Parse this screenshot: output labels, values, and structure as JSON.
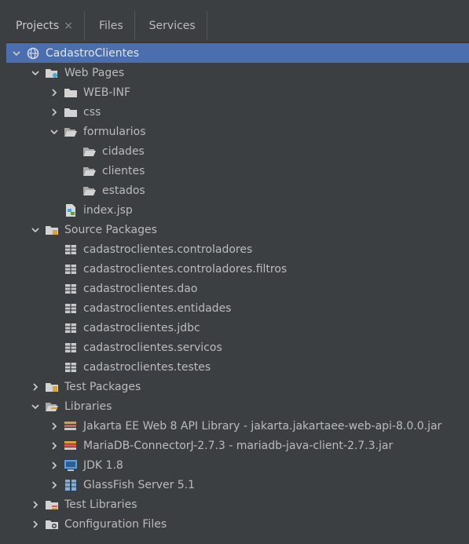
{
  "tabs": [
    {
      "label": "Projects",
      "close": "×"
    },
    {
      "label": "Files"
    },
    {
      "label": "Services"
    }
  ],
  "colors": {
    "background": "#3c3f41",
    "selection": "#4b6eaf",
    "folder": "#d3d3d3",
    "package": "#c9c9c9",
    "jar": "#d9a23a",
    "jdk": "#5aa0e6",
    "server": "#7fb0e0"
  },
  "tree": [
    {
      "label": "CadastroClientes",
      "icon": "globe-icon",
      "depth": 0,
      "chevron": "down",
      "selected": true
    },
    {
      "label": "Web Pages",
      "icon": "web-folder-icon",
      "depth": 1,
      "chevron": "down"
    },
    {
      "label": "WEB-INF",
      "icon": "folder-closed-icon",
      "depth": 2,
      "chevron": "right"
    },
    {
      "label": "css",
      "icon": "folder-closed-icon",
      "depth": 2,
      "chevron": "right"
    },
    {
      "label": "formularios",
      "icon": "folder-open-icon",
      "depth": 2,
      "chevron": "down"
    },
    {
      "label": "cidades",
      "icon": "folder-open-icon",
      "depth": 3
    },
    {
      "label": "clientes",
      "icon": "folder-open-icon",
      "depth": 3
    },
    {
      "label": "estados",
      "icon": "folder-open-icon",
      "depth": 3
    },
    {
      "label": "index.jsp",
      "icon": "jsp-file-icon",
      "depth": 2
    },
    {
      "label": "Source Packages",
      "icon": "source-folder-icon",
      "depth": 1,
      "chevron": "down"
    },
    {
      "label": "cadastroclientes.controladores",
      "icon": "package-icon",
      "depth": 2
    },
    {
      "label": "cadastroclientes.controladores.filtros",
      "icon": "package-icon",
      "depth": 2
    },
    {
      "label": "cadastroclientes.dao",
      "icon": "package-icon",
      "depth": 2
    },
    {
      "label": "cadastroclientes.entidades",
      "icon": "package-icon",
      "depth": 2
    },
    {
      "label": "cadastroclientes.jdbc",
      "icon": "package-icon",
      "depth": 2
    },
    {
      "label": "cadastroclientes.servicos",
      "icon": "package-icon",
      "depth": 2
    },
    {
      "label": "cadastroclientes.testes",
      "icon": "package-icon",
      "depth": 2
    },
    {
      "label": "Test Packages",
      "icon": "test-folder-icon",
      "depth": 1,
      "chevron": "right"
    },
    {
      "label": "Libraries",
      "icon": "libraries-folder-icon",
      "depth": 1,
      "chevron": "down"
    },
    {
      "label": "Jakarta EE Web 8 API Library - jakarta.jakartaee-web-api-8.0.0.jar",
      "icon": "library-icon",
      "depth": 2,
      "chevron": "right"
    },
    {
      "label": "MariaDB-ConnectorJ-2.7.3 - mariadb-java-client-2.7.3.jar",
      "icon": "library-icon",
      "depth": 2,
      "chevron": "right"
    },
    {
      "label": "JDK 1.8",
      "icon": "jdk-icon",
      "depth": 2,
      "chevron": "right"
    },
    {
      "label": "GlassFish Server 5.1",
      "icon": "server-icon",
      "depth": 2,
      "chevron": "right"
    },
    {
      "label": "Test Libraries",
      "icon": "test-libraries-icon",
      "depth": 1,
      "chevron": "right"
    },
    {
      "label": "Configuration Files",
      "icon": "config-folder-icon",
      "depth": 1,
      "chevron": "right"
    }
  ]
}
